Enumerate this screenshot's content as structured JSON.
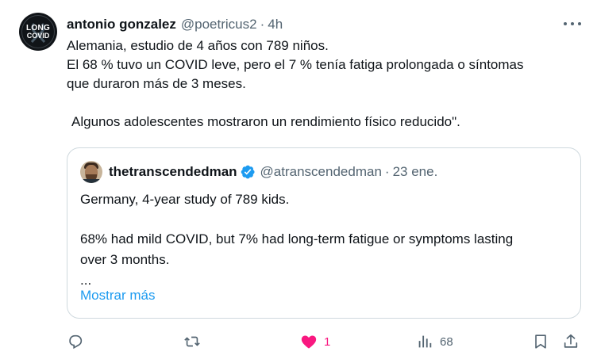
{
  "post": {
    "author_name": "antonio gonzalez",
    "author_handle": "@poetricus2",
    "separator": "·",
    "time": "4h",
    "avatar_logo": {
      "line1": "LONG",
      "line2": "COVID"
    },
    "text_lines": [
      "Alemania, estudio de 4 años con 789 niños.",
      "El 68 % tuvo un COVID leve, pero el 7 % tenía fatiga prolongada o síntomas",
      "que duraron más de 3 meses.",
      "Algunos adolescentes mostraron un rendimiento físico reducido\"."
    ]
  },
  "quote": {
    "author_name": "thetranscendedman",
    "author_handle": "@atranscendedman",
    "separator": "·",
    "date": "23 ene.",
    "text_lines": [
      "Germany, 4-year study of 789 kids.",
      "68% had mild COVID, but 7% had long-term fatigue or symptoms lasting",
      "over 3 months.",
      "..."
    ],
    "show_more": "Mostrar más"
  },
  "actions": {
    "reply_count": "",
    "repost_count": "",
    "like_count": "1",
    "views_count": "68",
    "liked": true
  },
  "colors": {
    "text": "#0f1419",
    "secondary": "#536471",
    "link": "#1d9bf0",
    "like": "#f91880",
    "border": "#cfd9de",
    "verified": "#1d9bf0"
  },
  "icons": [
    "more-icon",
    "verified-badge-icon",
    "reply-icon",
    "repost-icon",
    "heart-icon",
    "views-icon",
    "bookmark-icon",
    "share-icon"
  ]
}
